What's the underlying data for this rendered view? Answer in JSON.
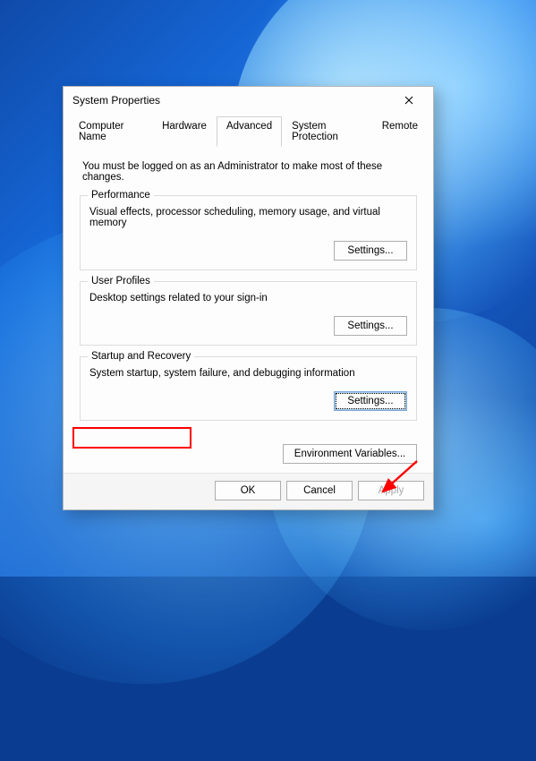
{
  "dialog": {
    "title": "System Properties",
    "close_aria": "Close"
  },
  "tabs": [
    {
      "label": "Computer Name"
    },
    {
      "label": "Hardware"
    },
    {
      "label": "Advanced",
      "active": true
    },
    {
      "label": "System Protection"
    },
    {
      "label": "Remote"
    }
  ],
  "advanced": {
    "instruction": "You must be logged on as an Administrator to make most of these changes.",
    "performance": {
      "legend": "Performance",
      "text": "Visual effects, processor scheduling, memory usage, and virtual memory",
      "button": "Settings..."
    },
    "user_profiles": {
      "legend": "User Profiles",
      "text": "Desktop settings related to your sign-in",
      "button": "Settings..."
    },
    "startup": {
      "legend": "Startup and Recovery",
      "text": "System startup, system failure, and debugging information",
      "button": "Settings..."
    },
    "env_button": "Environment Variables..."
  },
  "buttons": {
    "ok": "OK",
    "cancel": "Cancel",
    "apply": "Apply"
  },
  "annotations": {
    "highlight_target": "startup-legend",
    "arrow_target": "startup-settings-button"
  },
  "colors": {
    "annotation": "#ff0000",
    "dialog_bg": "#fdfdfd",
    "border": "#adadad"
  }
}
